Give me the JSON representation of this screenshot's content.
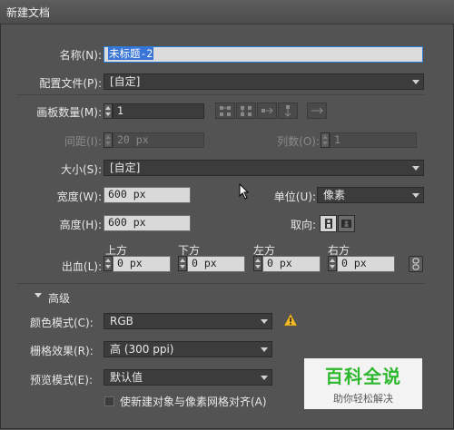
{
  "window": {
    "title": "新建文档"
  },
  "name": {
    "label": "名称(N):",
    "value": "未标题-2"
  },
  "profile": {
    "label": "配置文件(P):",
    "value": "[自定]"
  },
  "artboards": {
    "label": "画板数量(M):",
    "value": "1"
  },
  "spacing": {
    "label": "间距(I):",
    "value": "20 px"
  },
  "columns": {
    "label": "列数(O):",
    "value": "1"
  },
  "size": {
    "label": "大小(S):",
    "value": "[自定]"
  },
  "width": {
    "label": "宽度(W):",
    "value": "600 px"
  },
  "units": {
    "label": "单位(U):",
    "value": "像素"
  },
  "height": {
    "label": "高度(H):",
    "value": "600 px"
  },
  "orientation": {
    "label": "取向:"
  },
  "bleed": {
    "label": "出血(L):",
    "top_label": "上方",
    "top": "0 px",
    "bottom_label": "下方",
    "bottom": "0 px",
    "left_label": "左方",
    "left": "0 px",
    "right_label": "右方",
    "right": "0 px"
  },
  "advanced": {
    "label": "高级"
  },
  "color_mode": {
    "label": "颜色模式(C):",
    "value": "RGB"
  },
  "raster": {
    "label": "栅格效果(R):",
    "value": "高 (300 ppi)"
  },
  "preview": {
    "label": "预览模式(E):",
    "value": "默认值"
  },
  "align_pixel": {
    "label": "使新建对象与像素网格对齐(A)",
    "checked": false
  },
  "watermark": {
    "main": "百科全说",
    "sub": "助你轻松解决"
  },
  "colors": {
    "warning": "#f2b92a",
    "selection": "#3875d7",
    "watermark": "#2eb82e"
  }
}
